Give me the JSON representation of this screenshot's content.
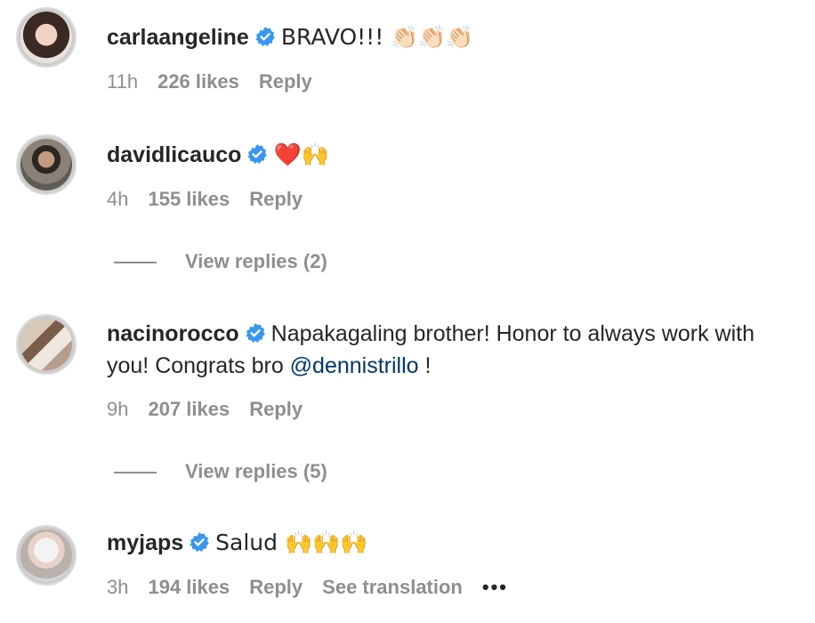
{
  "comments": [
    {
      "username": "carlaangeline",
      "text": "BRAVO!!! 👏🏻👏🏻👏🏻",
      "mention": "",
      "suffix": "",
      "time": "11h",
      "likes": "226 likes",
      "reply": "Reply"
    },
    {
      "username": "davidlicauco",
      "text": "❤️🙌",
      "mention": "",
      "suffix": "",
      "time": "4h",
      "likes": "155 likes",
      "reply": "Reply",
      "view_replies": "View replies (2)"
    },
    {
      "username": "nacinorocco",
      "text": "Napakagaling brother! Honor to always work with you! Congrats bro ",
      "mention": "@dennistrillo",
      "suffix": " !",
      "time": "9h",
      "likes": "207 likes",
      "reply": "Reply",
      "view_replies": "View replies (5)"
    },
    {
      "username": "myjaps",
      "text": "Salud 🙌🙌🙌",
      "mention": "",
      "suffix": "",
      "time": "3h",
      "likes": "194 likes",
      "reply": "Reply",
      "see_translation": "See translation",
      "more": "•••"
    }
  ],
  "colors": {
    "verified_blue": "#3897f0",
    "meta_gray": "#8e8e8e",
    "mention_blue": "#00376b"
  }
}
